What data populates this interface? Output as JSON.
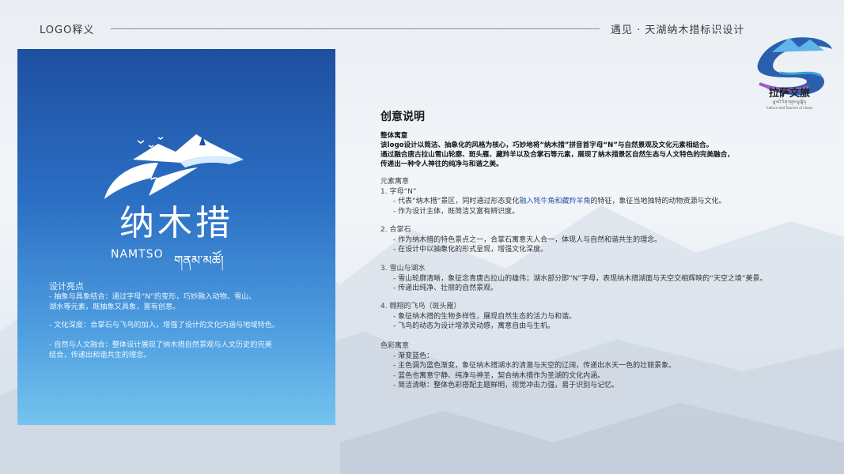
{
  "header": {
    "left_title": "LOGO释义",
    "right_title": "遇见 · 天湖纳木措标识设计"
  },
  "brand": {
    "name_cn": "拉萨文旅",
    "name_tibetan": "ལྷ་སའི་རིག་གནས་ལྟ་སྐོར།",
    "name_en": "Culture and Tourism of Lhasa"
  },
  "panel": {
    "logo_cn": "纳木措",
    "logo_en": "NAMTSO",
    "logo_tibetan": "གནམ་མཚོ།",
    "highlights_title": "设计亮点",
    "highlights": [
      [
        "- 抽象与具象结合：通过字母“N”的变形，巧妙融入动物、雪山、",
        "  湖水等元素，既抽象又具象，富有创意。"
      ],
      [
        "- 文化深度：合掌石与飞鸟的加入，增强了设计的文化内涵与地域特色。"
      ],
      [
        "- 自然与人文融合：整体设计展现了纳木措自然景观与人文历史的完美",
        "  结合，传递出和谐共生的理念。"
      ]
    ]
  },
  "creative": {
    "title": "创意说明",
    "overall_title": "整体寓意",
    "overall_lines": [
      "该logo设计以简洁、抽象化的风格为核心，巧妙地将“纳木措”拼音首字母“N”与自然景观及文化元素相结合。",
      "通过融合唐古拉山雪山轮廓、斑头雁、藏羚羊以及合掌石等元素，展现了纳木措景区自然生态与人文特色的完美融合，",
      "传递出一种令人神往的纯净与和谐之美。"
    ],
    "elements_title": "元素寓意",
    "el1_head": "1.  字母“N”",
    "el1_sub1_a": "- 代表“纳木措”景区，同时通过形态变化",
    "el1_sub1_hl": "融入牦牛角和藏羚羊角",
    "el1_sub1_b": "的特征，象征当地独特的动物资源与文化。",
    "el1_sub2": "- 作为设计主体，既简洁又富有辨识度。",
    "el2_head": "2.  合掌石",
    "el2_sub1": "- 作为纳木措的特色景点之一，合掌石寓意天人合一，体现人与自然和谐共生的理念。",
    "el2_sub2": "- 在设计中以抽象化的形式呈现，增强文化深度。",
    "el3_head": "3.  雪山与湖水",
    "el3_sub1": "- 雪山轮廓清晰，象征念青唐古拉山的雄伟；湖水部分即“N”字母，表现纳木措湖面与天空交相辉映的“天空之境”美景。",
    "el3_sub2": "- 传递出纯净、壮丽的自然景观。",
    "el4_head": "4.  翱翔的飞鸟（斑头雁）",
    "el4_sub1": "- 象征纳木措的生物多样性，展现自然生态的活力与和谐。",
    "el4_sub2": "- 飞鸟的动态为设计增添灵动感，寓意自由与生机。",
    "color_title": "色彩寓意",
    "color_lines": [
      "- 渐变蓝色：",
      "- 主色调为蓝色渐变，象征纳木措湖水的清澈与天空的辽阔，传递出水天一色的壮丽景象。",
      "- 蓝色也寓意宁静、纯净与神圣，契合纳木措作为圣湖的文化内涵。",
      "- 简洁清晰：整体色彩搭配主题鲜明，视觉冲击力强，易于识别与记忆。"
    ]
  },
  "colors": {
    "panel_top": "#1e4fa0",
    "panel_bottom": "#74c4ee",
    "highlight_text": "#2c57a8"
  }
}
